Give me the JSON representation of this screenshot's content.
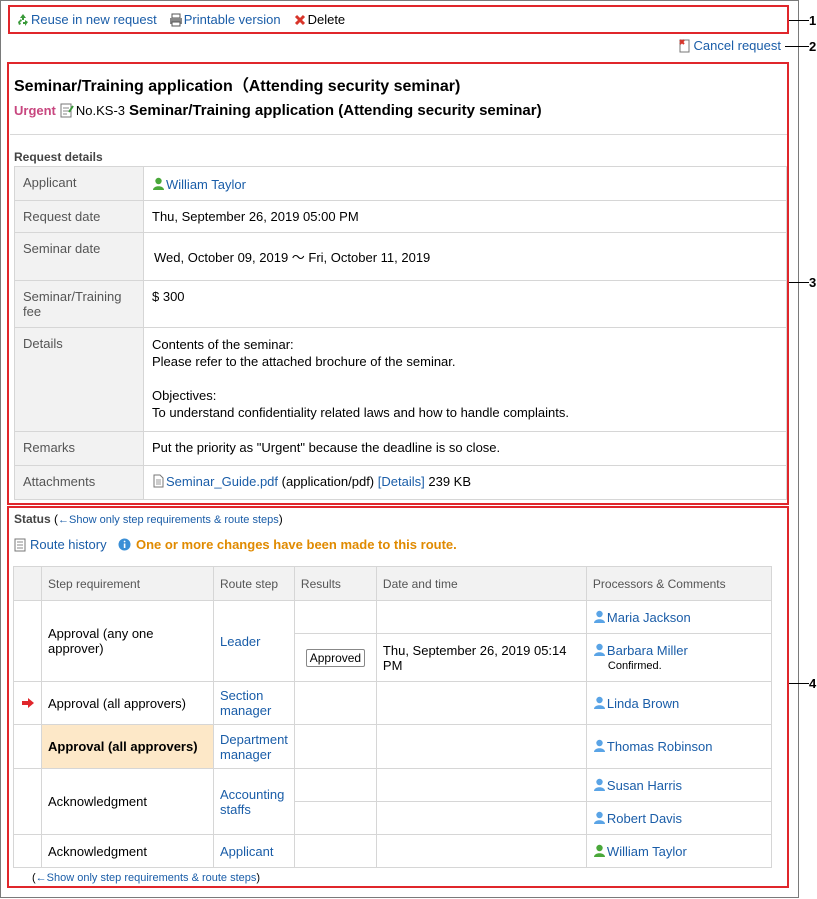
{
  "toolbar": {
    "reuse_label": "Reuse in new request",
    "print_label": "Printable version",
    "delete_label": "Delete",
    "cancel_label": "Cancel request"
  },
  "callouts": [
    "1",
    "2",
    "3",
    "4"
  ],
  "request": {
    "title": "Seminar/Training application（Attending security seminar)",
    "priority": "Urgent",
    "number": "No.KS-3",
    "name": "Seminar/Training application (Attending security seminar)",
    "details_heading": "Request details",
    "fields": {
      "applicant_label": "Applicant",
      "applicant_value": "William Taylor",
      "request_date_label": "Request date",
      "request_date_value": "Thu, September 26, 2019 05:00 PM",
      "seminar_date_label": "Seminar date",
      "seminar_date_value": "Wed, October 09, 2019 〜 Fri, October 11, 2019",
      "fee_label": "Seminar/Training fee",
      "fee_value": "$ 300",
      "details_label": "Details",
      "details_line1": "Contents of the seminar:",
      "details_line2": "Please refer to the attached brochure of the seminar.",
      "details_line3": "Objectives:",
      "details_line4": "To understand confidentiality related laws and how to handle complaints.",
      "remarks_label": "Remarks",
      "remarks_value": "Put the priority as \"Urgent\" because the deadline is so close.",
      "attachments_label": "Attachments",
      "attachment_file": "Seminar_Guide.pdf",
      "attachment_type": "(application/pdf)",
      "attachment_details": "[Details]",
      "attachment_size": "239 KB"
    }
  },
  "status": {
    "heading": "Status",
    "toggle_link": "←Show only step requirements & route steps",
    "route_history": "Route history",
    "notice": "One or more changes have been made to this route.",
    "columns": [
      "Step requirement",
      "Route step",
      "Results",
      "Date and time",
      "Processors & Comments"
    ],
    "rows": {
      "r1_req": "Approval (any one approver)",
      "r1_step": "Leader",
      "r1_proc1": "Maria Jackson",
      "r1_result2": "Approved",
      "r1_date2": "Thu, September 26, 2019 05:14 PM",
      "r1_proc2": "Barbara Miller",
      "r1_comment2": "Confirmed.",
      "r2_req": "Approval (all approvers)",
      "r2_step": "Section manager",
      "r2_proc": "Linda Brown",
      "r3_req": "Approval (all approvers)",
      "r3_step": "Department manager",
      "r3_proc": "Thomas Robinson",
      "r4_req": "Acknowledgment",
      "r4_step": "Accounting staffs",
      "r4_proc1": "Susan Harris",
      "r4_proc2": "Robert Davis",
      "r5_req": "Acknowledgment",
      "r5_step": "Applicant",
      "r5_proc": "William Taylor"
    }
  },
  "colors": {
    "callout_red": "#e0262b",
    "link_blue": "#1a5da8",
    "urgent": "#c8467f",
    "notice": "#e08a00",
    "highlight": "#fde8c8"
  }
}
